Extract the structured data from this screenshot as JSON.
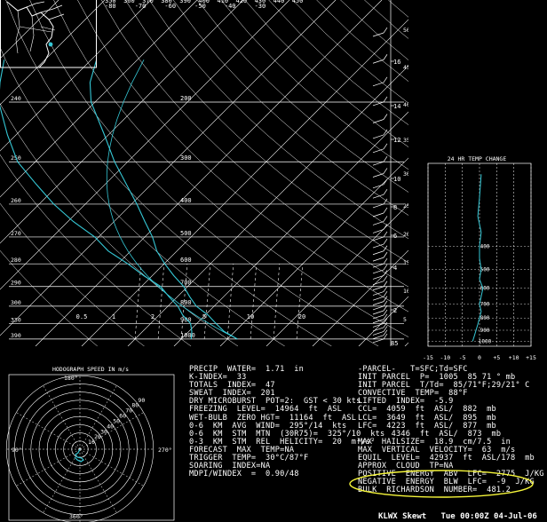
{
  "header": {
    "top_ticks": [
      "350",
      "360",
      "370",
      "380",
      "390",
      "400",
      "410",
      "420",
      "430",
      "440",
      "450"
    ],
    "top_ticks_sub": [
      "-80",
      "-70",
      "-60",
      "-50",
      "-40",
      "-30"
    ]
  },
  "chart_data": [
    {
      "type": "line",
      "name": "skewt",
      "pressure_levels": [
        1000,
        900,
        800,
        700,
        600,
        500,
        400,
        300,
        200
      ],
      "left_heights": [
        "390",
        "330",
        "300",
        "290",
        "280",
        "270",
        "260",
        "250",
        "240"
      ],
      "ylabel_left": "",
      "mixing_ratio_labels": [
        "0.5",
        "1",
        "2",
        "5",
        "10",
        "20"
      ],
      "right_km_labels": [
        "2",
        "4",
        "6",
        "8",
        "10",
        "12",
        "14",
        "16"
      ],
      "right_kft_labels": [
        "5",
        "10",
        "15",
        "20",
        "25",
        "30",
        "35",
        "40",
        "45",
        "50"
      ],
      "right_kft_bottom": "85",
      "series": [
        {
          "values": [
            [
              1000,
              31.0
            ],
            [
              950,
              26.5
            ],
            [
              900,
              23.0
            ],
            [
              850,
              19.5
            ],
            [
              800,
              15.0
            ],
            [
              750,
              11.5
            ],
            [
              700,
              8.0
            ],
            [
              650,
              3.5
            ],
            [
              600,
              -1.0
            ],
            [
              550,
              -5.5
            ],
            [
              500,
              -9.5
            ],
            [
              450,
              -14.5
            ],
            [
              400,
              -20.0
            ],
            [
              350,
              -26.5
            ],
            [
              300,
              -34.0
            ],
            [
              250,
              -42.0
            ],
            [
              200,
              -52.0
            ],
            [
              175,
              -56.5
            ],
            [
              150,
              -60.0
            ]
          ]
        },
        {
          "values": [
            [
              1000,
              21.0
            ],
            [
              950,
              19.5
            ],
            [
              900,
              17.5
            ],
            [
              850,
              14.0
            ],
            [
              800,
              11.0
            ],
            [
              750,
              7.0
            ],
            [
              700,
              3.0
            ],
            [
              650,
              -3.0
            ],
            [
              600,
              -9.0
            ],
            [
              550,
              -16.0
            ],
            [
              500,
              -22.0
            ],
            [
              450,
              -30.0
            ],
            [
              400,
              -38.0
            ],
            [
              350,
              -46.0
            ],
            [
              300,
              -55.0
            ],
            [
              250,
              -63.0
            ],
            [
              200,
              -72.0
            ],
            [
              175,
              -76.0
            ],
            [
              150,
              -80.0
            ]
          ]
        }
      ]
    },
    {
      "type": "line",
      "name": "24-hour-temp-change",
      "title": "24 HR TEMP CHANGE",
      "x_ticks": [
        "-15",
        "-10",
        "-5",
        "0",
        "+5",
        "+10",
        "+15"
      ],
      "xlim": [
        -15,
        15
      ],
      "levels": [
        "400",
        "500",
        "600",
        "700",
        "800",
        "900",
        "1000"
      ],
      "series": [
        {
          "values": [
            [
              1000,
              -2
            ],
            [
              950,
              -1.5
            ],
            [
              900,
              -1
            ],
            [
              850,
              -0.5
            ],
            [
              800,
              0
            ],
            [
              750,
              0.5
            ],
            [
              700,
              0
            ],
            [
              650,
              0.5
            ],
            [
              600,
              1
            ],
            [
              550,
              0
            ],
            [
              500,
              0.5
            ],
            [
              450,
              0
            ],
            [
              400,
              0
            ],
            [
              350,
              0.5
            ],
            [
              300,
              -0.5
            ],
            [
              250,
              0
            ],
            [
              200,
              0.5
            ]
          ]
        }
      ]
    },
    {
      "type": "line",
      "name": "hodograph",
      "title": "HODOGRAPH SPEED IN m/s",
      "ring_labels": [
        "10",
        "20",
        "30",
        "40",
        "50",
        "60",
        "70",
        "80",
        "90"
      ],
      "direction_labels": [
        "180°",
        "270°",
        "360°",
        "90°"
      ],
      "series": [
        {
          "values": [
            [
              0,
              0
            ],
            [
              -2,
              -4
            ],
            [
              -5,
              -6
            ],
            [
              -3,
              -9
            ],
            [
              2,
              -10
            ],
            [
              4,
              -12
            ],
            [
              1,
              -14
            ],
            [
              -3,
              -12
            ],
            [
              -6,
              -9
            ]
          ]
        }
      ]
    }
  ],
  "indices": {
    "left": [
      "PRECIP  WATER=  1.71  in",
      "K-INDEX=  33",
      "TOTALS  INDEX=  47",
      "SWEAT  INDEX=  201",
      "DRY MICROBURST  POT=2:  GST < 30 kts",
      "FREEZING  LEVEL=  14964  ft  ASL",
      "WET-BULB  ZERO HGT=  11164  ft  ASL",
      "0-6  KM  AVG  WIND=  295°/14  kts",
      "0-6  KM  STM  MTN  (30R75)=  325°/10  kts",
      "0-3  KM  STM  REL  HELICITY=  20  m²/s²",
      "FORECAST  MAX  TEMP=NA",
      "TRIGGER  TEMP=  30°C/87°F",
      "SOARING  INDEX=NA",
      "MDPI/WINDEX  =  0.90/48"
    ],
    "right": [
      "-PARCEL-   T=SFC;Td=SFC",
      "INIT PARCEL  P=  1005  85 71 ° mb",
      "INIT PARCEL  T/Td=  85/71°F;29/21° C",
      "CONVECTIVE  TEMP=  88°F",
      "LIFTED  INDEX=  -5.9",
      "CCL=  4059  ft  ASL/  882  mb",
      "LCL=  3649  ft  ASL/  895  mb",
      "LFC=  4223  ft  ASL/  877  mb",
      "       4346  ft  ASL/  873  mb",
      "MAX  HAILSIZE=  18.9  cm/7.5  in",
      "MAX  VERTICAL  VELOCITY=  63  m/s",
      "EQUIL  LEVEL=  42937  ft  ASL/178  mb",
      "APPROX  CLOUD  TP=NA",
      "POSITIVE  ENERGY  ABV  LFC=  2775  J/KG",
      "NEGATIVE  ENERGY  BLW  LFC=  -9  J/KG",
      "BULK  RICHARDSON  NUMBER=  481.2"
    ]
  },
  "footer": {
    "text": "KLWX Skewt   Tue 00:00Z 04-Jul-06"
  },
  "colors": {
    "background": "#000000",
    "trace": "#35c8d6",
    "highlight": "#f5f53a",
    "grid": "#ffffff"
  }
}
